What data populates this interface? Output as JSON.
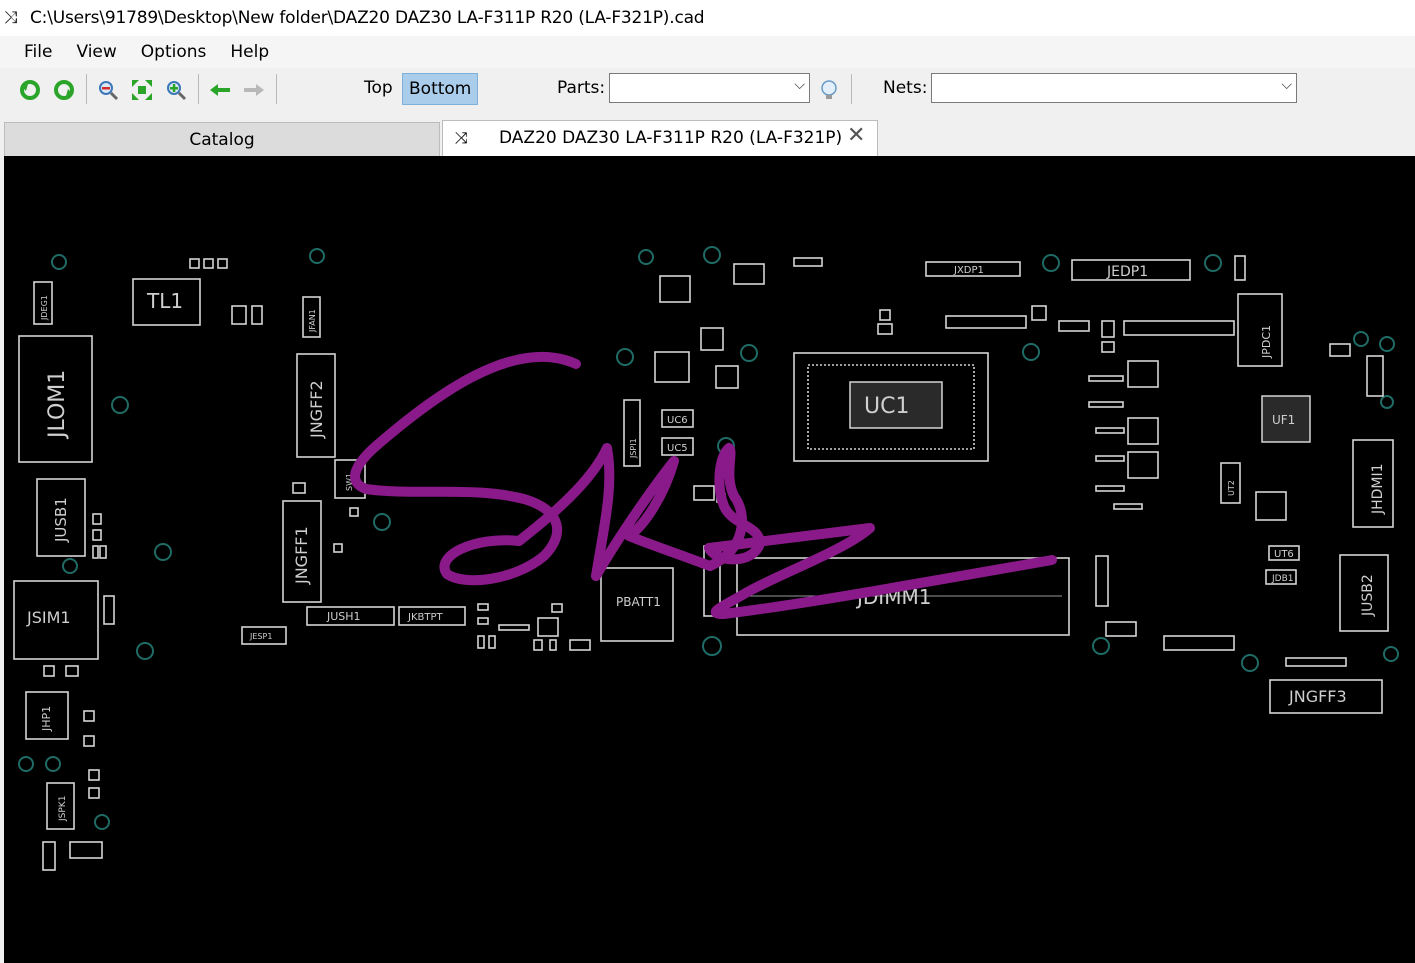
{
  "window": {
    "title": "C:\\Users\\91789\\Desktop\\New folder\\DAZ20 DAZ30 LA-F311P R20 (LA-F321P).cad"
  },
  "menu": {
    "file": "File",
    "view": "View",
    "options": "Options",
    "help": "Help"
  },
  "toolbar": {
    "top_label": "Top",
    "bottom_label": "Bottom",
    "active_side": "Bottom",
    "parts_label": "Parts:",
    "parts_value": "",
    "nets_label": "Nets:",
    "nets_value": ""
  },
  "tabs": [
    {
      "label": "Catalog"
    },
    {
      "label": "DAZ20 DAZ30 LA-F311P R20 (LA-F321P)"
    }
  ],
  "board": {
    "components": {
      "tl1": "TL1",
      "jlom1": "JLOM1",
      "jngff2": "JNGFF2",
      "jngff1": "JNGFF1",
      "jusb1": "JUSB1",
      "jsim1": "JSIM1",
      "jhp1": "JHP1",
      "jspk1": "JSPK1",
      "jfan1": "JFAN1",
      "jdeg1": "JDEG1",
      "jush1": "JUSH1",
      "jkbtpt": "JKBTPT",
      "jesp1": "JESP1",
      "uc6": "UC6",
      "uc5": "UC5",
      "jspi1": "JSPI1",
      "sw1": "SW1",
      "pbatt1": "PBATT1",
      "uc1": "UC1",
      "jdimm1": "JDIMM1",
      "jxdp1": "JXDP1",
      "jedp1": "JEDP1",
      "jpdc1": "JPDC1",
      "ut2": "UT2",
      "ut6": "UT6",
      "jdb1": "JDB1",
      "jhdmi1": "JHDMI1",
      "jusb2": "JUSB2",
      "jngff3": "JNGFF3",
      "uf1": "UF1"
    }
  },
  "colors": {
    "board_bg": "#000000",
    "outline": "#d4d4d4",
    "via_ring": "#1f6b66",
    "annotation": "#8a1a8a",
    "active_toggle": "#a9cdea"
  }
}
